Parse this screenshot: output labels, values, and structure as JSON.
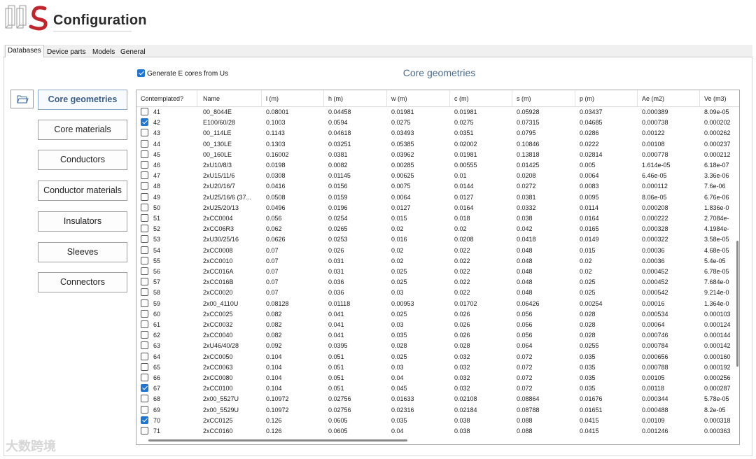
{
  "app": {
    "title": "Configuration"
  },
  "tabs": [
    "Databases",
    "Device parts",
    "Models",
    "General"
  ],
  "generate_checkbox": {
    "label": "Generate E cores from Us",
    "checked": true
  },
  "section_title": "Core geometries",
  "nav": {
    "folder_icon": "folder-open-icon",
    "items": [
      "Core geometries",
      "Core materials",
      "Conductors",
      "Conductor materials",
      "Insulators",
      "Sleeves",
      "Connectors"
    ],
    "active": "Core geometries"
  },
  "table": {
    "columns": [
      "Contemplated?",
      "Name",
      "l (m)",
      "h (m)",
      "w (m)",
      "c (m)",
      "s (m)",
      "p (m)",
      "Ae (m2)",
      "Ve (m3)"
    ],
    "rows": [
      {
        "checked": false,
        "id": "41",
        "name": "00_8044E",
        "l": "0.08001",
        "h": "0.04458",
        "w": "0.01981",
        "c": "0.01981",
        "s": "0.05928",
        "p": "0.03437",
        "ae": "0.000389",
        "ve": "8.09e-05"
      },
      {
        "checked": true,
        "id": "42",
        "name": "E100/60/28",
        "l": "0.1003",
        "h": "0.0594",
        "w": "0.0275",
        "c": "0.0275",
        "s": "0.07315",
        "p": "0.04685",
        "ae": "0.000738",
        "ve": "0.000202"
      },
      {
        "checked": false,
        "id": "43",
        "name": "00_114LE",
        "l": "0.1143",
        "h": "0.04618",
        "w": "0.03493",
        "c": "0.0351",
        "s": "0.0795",
        "p": "0.0286",
        "ae": "0.00122",
        "ve": "0.000262"
      },
      {
        "checked": false,
        "id": "44",
        "name": "00_130LE",
        "l": "0.1303",
        "h": "0.03251",
        "w": "0.05385",
        "c": "0.02002",
        "s": "0.10846",
        "p": "0.0222",
        "ae": "0.00108",
        "ve": "0.000237"
      },
      {
        "checked": false,
        "id": "45",
        "name": "00_160LE",
        "l": "0.16002",
        "h": "0.0381",
        "w": "0.03962",
        "c": "0.01981",
        "s": "0.13818",
        "p": "0.02814",
        "ae": "0.000778",
        "ve": "0.000212"
      },
      {
        "checked": false,
        "id": "46",
        "name": "2xU10/8/3",
        "l": "0.0198",
        "h": "0.0082",
        "w": "0.00285",
        "c": "0.00555",
        "s": "0.01425",
        "p": "0.005",
        "ae": "1.614e-05",
        "ve": "6.18e-07"
      },
      {
        "checked": false,
        "id": "47",
        "name": "2xU15/11/6",
        "l": "0.0308",
        "h": "0.01145",
        "w": "0.00625",
        "c": "0.01",
        "s": "0.0208",
        "p": "0.0064",
        "ae": "6.46e-05",
        "ve": "3.36e-06"
      },
      {
        "checked": false,
        "id": "48",
        "name": "2xU20/16/7",
        "l": "0.0416",
        "h": "0.0156",
        "w": "0.0075",
        "c": "0.0144",
        "s": "0.0272",
        "p": "0.0083",
        "ae": "0.000112",
        "ve": "7.6e-06"
      },
      {
        "checked": false,
        "id": "49",
        "name": "2xU25/16/6 (37...",
        "l": "0.0508",
        "h": "0.0159",
        "w": "0.0064",
        "c": "0.0127",
        "s": "0.0381",
        "p": "0.0095",
        "ae": "8.06e-05",
        "ve": "6.76e-06"
      },
      {
        "checked": false,
        "id": "50",
        "name": "2xU25/20/13",
        "l": "0.0496",
        "h": "0.0196",
        "w": "0.0127",
        "c": "0.0164",
        "s": "0.0332",
        "p": "0.0114",
        "ae": "0.000208",
        "ve": "1.836e-0"
      },
      {
        "checked": false,
        "id": "51",
        "name": "2xCC0004",
        "l": "0.056",
        "h": "0.0254",
        "w": "0.015",
        "c": "0.018",
        "s": "0.038",
        "p": "0.0164",
        "ae": "0.000222",
        "ve": "2.7084e-"
      },
      {
        "checked": false,
        "id": "52",
        "name": "2xCC06R3",
        "l": "0.062",
        "h": "0.0265",
        "w": "0.02",
        "c": "0.02",
        "s": "0.042",
        "p": "0.0165",
        "ae": "0.000328",
        "ve": "4.1984e-"
      },
      {
        "checked": false,
        "id": "53",
        "name": "2xU30/25/16",
        "l": "0.0626",
        "h": "0.0253",
        "w": "0.016",
        "c": "0.0208",
        "s": "0.0418",
        "p": "0.0149",
        "ae": "0.000322",
        "ve": "3.58e-05"
      },
      {
        "checked": false,
        "id": "54",
        "name": "2xCC0008",
        "l": "0.07",
        "h": "0.026",
        "w": "0.02",
        "c": "0.022",
        "s": "0.048",
        "p": "0.015",
        "ae": "0.00036",
        "ve": "4.68e-05"
      },
      {
        "checked": false,
        "id": "55",
        "name": "2xCC0010",
        "l": "0.07",
        "h": "0.031",
        "w": "0.02",
        "c": "0.022",
        "s": "0.048",
        "p": "0.02",
        "ae": "0.00036",
        "ve": "5.4e-05"
      },
      {
        "checked": false,
        "id": "56",
        "name": "2xCC016A",
        "l": "0.07",
        "h": "0.031",
        "w": "0.025",
        "c": "0.022",
        "s": "0.048",
        "p": "0.02",
        "ae": "0.000452",
        "ve": "6.78e-05"
      },
      {
        "checked": false,
        "id": "57",
        "name": "2xCC016B",
        "l": "0.07",
        "h": "0.036",
        "w": "0.025",
        "c": "0.022",
        "s": "0.048",
        "p": "0.025",
        "ae": "0.000452",
        "ve": "7.684e-0"
      },
      {
        "checked": false,
        "id": "58",
        "name": "2xCC0020",
        "l": "0.07",
        "h": "0.036",
        "w": "0.03",
        "c": "0.022",
        "s": "0.048",
        "p": "0.025",
        "ae": "0.000542",
        "ve": "9.214e-0"
      },
      {
        "checked": false,
        "id": "59",
        "name": "2x00_4110U",
        "l": "0.08128",
        "h": "0.01118",
        "w": "0.00953",
        "c": "0.01702",
        "s": "0.06426",
        "p": "0.00254",
        "ae": "0.00016",
        "ve": "1.364e-0"
      },
      {
        "checked": false,
        "id": "60",
        "name": "2xCC0025",
        "l": "0.082",
        "h": "0.041",
        "w": "0.025",
        "c": "0.026",
        "s": "0.056",
        "p": "0.028",
        "ae": "0.000534",
        "ve": "0.000103"
      },
      {
        "checked": false,
        "id": "61",
        "name": "2xCC0032",
        "l": "0.082",
        "h": "0.041",
        "w": "0.03",
        "c": "0.026",
        "s": "0.056",
        "p": "0.028",
        "ae": "0.00064",
        "ve": "0.000124"
      },
      {
        "checked": false,
        "id": "62",
        "name": "2xCC0040",
        "l": "0.082",
        "h": "0.041",
        "w": "0.035",
        "c": "0.026",
        "s": "0.056",
        "p": "0.028",
        "ae": "0.000746",
        "ve": "0.000144"
      },
      {
        "checked": false,
        "id": "63",
        "name": "2xU46/40/28",
        "l": "0.092",
        "h": "0.0395",
        "w": "0.028",
        "c": "0.028",
        "s": "0.064",
        "p": "0.0255",
        "ae": "0.000784",
        "ve": "0.000142"
      },
      {
        "checked": false,
        "id": "64",
        "name": "2xCC0050",
        "l": "0.104",
        "h": "0.051",
        "w": "0.025",
        "c": "0.032",
        "s": "0.072",
        "p": "0.035",
        "ae": "0.000656",
        "ve": "0.000160"
      },
      {
        "checked": false,
        "id": "65",
        "name": "2xCC0063",
        "l": "0.104",
        "h": "0.051",
        "w": "0.03",
        "c": "0.032",
        "s": "0.072",
        "p": "0.035",
        "ae": "0.000788",
        "ve": "0.000192"
      },
      {
        "checked": false,
        "id": "66",
        "name": "2xCC0080",
        "l": "0.104",
        "h": "0.051",
        "w": "0.04",
        "c": "0.032",
        "s": "0.072",
        "p": "0.035",
        "ae": "0.00105",
        "ve": "0.000256"
      },
      {
        "checked": true,
        "id": "67",
        "name": "2xCC0100",
        "l": "0.104",
        "h": "0.051",
        "w": "0.045",
        "c": "0.032",
        "s": "0.072",
        "p": "0.035",
        "ae": "0.00118",
        "ve": "0.000287"
      },
      {
        "checked": false,
        "id": "68",
        "name": "2x00_5527U",
        "l": "0.10972",
        "h": "0.02756",
        "w": "0.01633",
        "c": "0.02108",
        "s": "0.08864",
        "p": "0.01676",
        "ae": "0.000344",
        "ve": "5.78e-05"
      },
      {
        "checked": false,
        "id": "69",
        "name": "2x00_5529U",
        "l": "0.10972",
        "h": "0.02756",
        "w": "0.02316",
        "c": "0.02184",
        "s": "0.08788",
        "p": "0.01651",
        "ae": "0.000488",
        "ve": "8.2e-05"
      },
      {
        "checked": true,
        "id": "70",
        "name": "2xCC0125",
        "l": "0.126",
        "h": "0.0605",
        "w": "0.035",
        "c": "0.038",
        "s": "0.088",
        "p": "0.0415",
        "ae": "0.00109",
        "ve": "0.000318"
      },
      {
        "checked": false,
        "id": "71",
        "name": "2xCC0160",
        "l": "0.126",
        "h": "0.0605",
        "w": "0.04",
        "c": "0.038",
        "s": "0.088",
        "p": "0.0415",
        "ae": "0.001246",
        "ve": "0.000363"
      }
    ]
  },
  "watermark": "大数跨境",
  "colors": {
    "accent": "#1f75d1",
    "title_blue": "#4a6a8e",
    "logo_red": "#c0242c"
  }
}
